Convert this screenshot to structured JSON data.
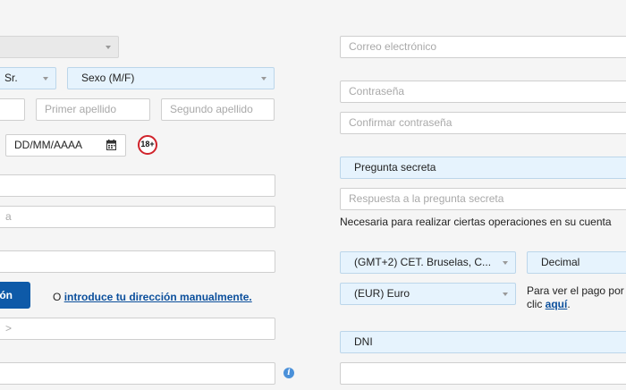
{
  "left": {
    "top_select": {
      "label": ""
    },
    "title_select": {
      "label": "Sr."
    },
    "gender_select": {
      "label": "Sexo (M/F)"
    },
    "name_field": {
      "placeholder": ""
    },
    "first_surname_field": {
      "placeholder": "Primer apellido"
    },
    "second_surname_field": {
      "placeholder": "Segundo apellido"
    },
    "birthdate_field": {
      "value": "DD/MM/AAAA"
    },
    "age_badge": "18+",
    "field_a": {
      "placeholder": ""
    },
    "field_b": {
      "placeholder": "a"
    },
    "field_c": {
      "placeholder": ""
    },
    "address_search_button": "ión",
    "manual_address": {
      "prefix": "O",
      "link": "introduce tu dirección manualmente."
    },
    "field_d": {
      "placeholder": ">"
    },
    "field_e": {
      "placeholder": ""
    },
    "info_icon": "i"
  },
  "right": {
    "email_field": {
      "placeholder": "Correo electrónico"
    },
    "password_field": {
      "placeholder": "Contraseña"
    },
    "confirm_password_field": {
      "placeholder": "Confirmar contraseña"
    },
    "security_question_select": {
      "label": "Pregunta secreta"
    },
    "security_answer_field": {
      "placeholder": "Respuesta a la pregunta secreta"
    },
    "security_note": "Necesaria para realizar ciertas operaciones en su cuenta",
    "timezone_select": {
      "label": "(GMT+2) CET. Bruselas, C..."
    },
    "odds_format_select": {
      "label": "Decimal"
    },
    "currency_select": {
      "label": "(EUR) Euro"
    },
    "payment_note": {
      "line1": "Para ver el pago por",
      "line2_prefix": "clic ",
      "link": "aquí",
      "line2_suffix": "."
    },
    "id_type_select": {
      "label": "DNI"
    },
    "id_number_field": {
      "placeholder": ""
    }
  },
  "colors": {
    "select_bg": "#e6f3fd",
    "button_bg": "#0e5aa8",
    "link": "#0b4f9c",
    "badge_ring": "#d0232b",
    "info_icon": "#4a90d9"
  },
  "icons": [
    "chevron-down-icon",
    "calendar-icon",
    "info-icon"
  ]
}
